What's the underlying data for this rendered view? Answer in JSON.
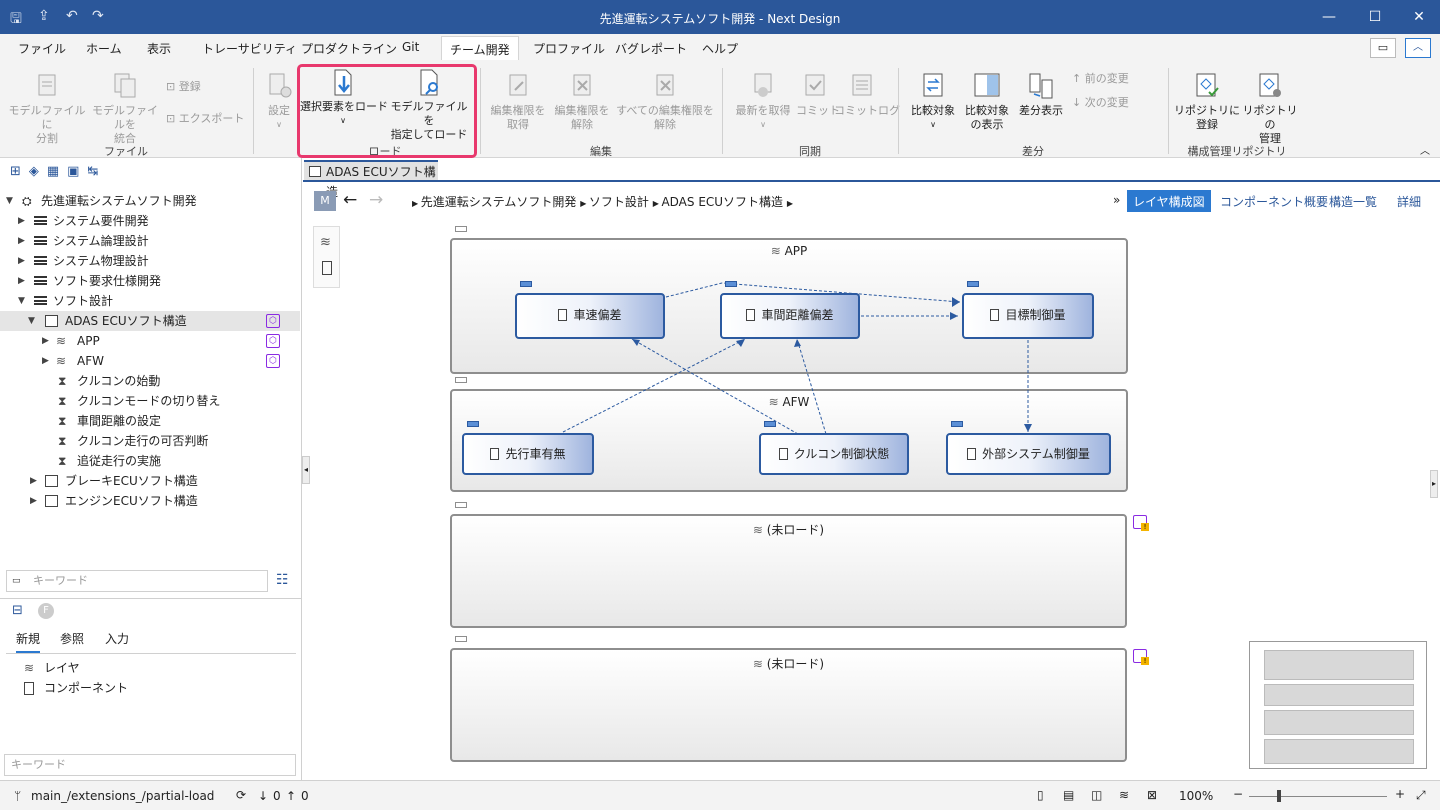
{
  "window": {
    "title": "先進運転システムソフト開発 - Next Design"
  },
  "menu": [
    "ファイル",
    "ホーム",
    "表示",
    "トレーサビリティ",
    "プロダクトライン",
    "Git",
    "チーム開発",
    "プロファイル",
    "バグレポート",
    "ヘルプ"
  ],
  "ribbon": {
    "split_label": "モデルファイルに\n分割",
    "merge_label": "モデルファイルを\n統合",
    "register_label": "登録",
    "export_label": "エクスポート",
    "group_file": "ファイル",
    "settings_label": "設定",
    "load_selected_label": "選択要素をロード",
    "load_file_label": "モデルファイルを\n指定してロード",
    "group_load": "ロード",
    "acquire_edit_label": "編集権限を\n取得",
    "release_edit_label": "編集権限を\n解除",
    "release_all_label": "すべての編集権限を\n解除",
    "group_edit": "編集",
    "fetch_latest_label": "最新を取得",
    "commit_label": "コミット",
    "commit_log_label": "コミットログ",
    "group_sync": "同期",
    "compare_target_label": "比較対象",
    "show_compare_label": "比較対象\nの表示",
    "diff_view_label": "差分表示",
    "prev_change_label": "前の変更",
    "next_change_label": "次の変更",
    "group_diff": "差分",
    "repo_register_label": "リポジトリに\n登録",
    "repo_manage_label": "リポジトリの\n管理",
    "group_repo": "構成管理リポジトリ"
  },
  "tree": {
    "root": "先進運転システムソフト開発",
    "items": [
      "システム要件開発",
      "システム論理設計",
      "システム物理設計",
      "ソフト要求仕様開発",
      "ソフト設計",
      "ADAS ECUソフト構造",
      "APP",
      "AFW",
      "クルコンの始動",
      "クルコンモードの切り替え",
      "車間距離の設定",
      "クルコン走行の可否判断",
      "追従走行の実施",
      "ブレーキECUソフト構造",
      "エンジンECUソフト構造"
    ]
  },
  "left_search_placeholder": "キーワード",
  "palette": {
    "tabs": [
      "新規",
      "参照",
      "入力"
    ],
    "items": [
      "レイヤ",
      "コンポーネント"
    ],
    "search_placeholder": "キーワード"
  },
  "editor": {
    "tab_title": "ADAS ECUソフト構造",
    "nav_m": "M",
    "breadcrumb": [
      "先進運転システムソフト開発",
      "ソフト設計",
      "ADAS ECUソフト構造"
    ],
    "views": [
      "レイヤ構成図",
      "コンポーネント概要",
      "構造一覧",
      "詳細"
    ],
    "more": "»"
  },
  "diagram": {
    "layers": [
      "APP",
      "AFW",
      "(未ロード)",
      "(未ロード)"
    ],
    "components": [
      "車速偏差",
      "車間距離偏差",
      "目標制御量",
      "先行車有無",
      "クルコン制御状態",
      "外部システム制御量"
    ]
  },
  "status": {
    "branch": "main_/extensions_/partial-load",
    "down": "0",
    "up": "0",
    "zoom": "100%"
  }
}
